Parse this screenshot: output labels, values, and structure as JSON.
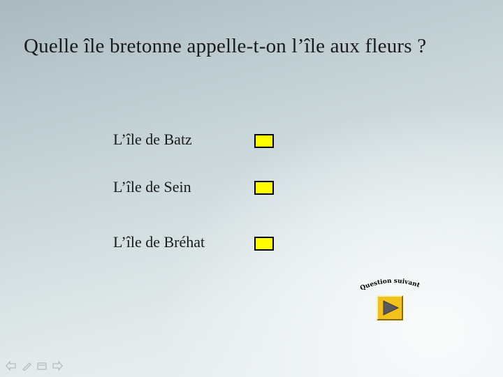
{
  "slide": {
    "question": "Quelle île bretonne appelle-t-on l’île aux fleurs ?",
    "answers": [
      {
        "label": "L’île de Batz"
      },
      {
        "label": "L’île de Sein"
      },
      {
        "label": "L’île de Bréhat"
      }
    ],
    "next_caption": "Question suivante",
    "answer_box_color": "#ffff00",
    "next_button_color": "#f2c21a"
  },
  "navigation": {
    "icons": [
      "back-arrow-icon",
      "pen-icon",
      "menu-icon",
      "forward-arrow-icon"
    ]
  }
}
